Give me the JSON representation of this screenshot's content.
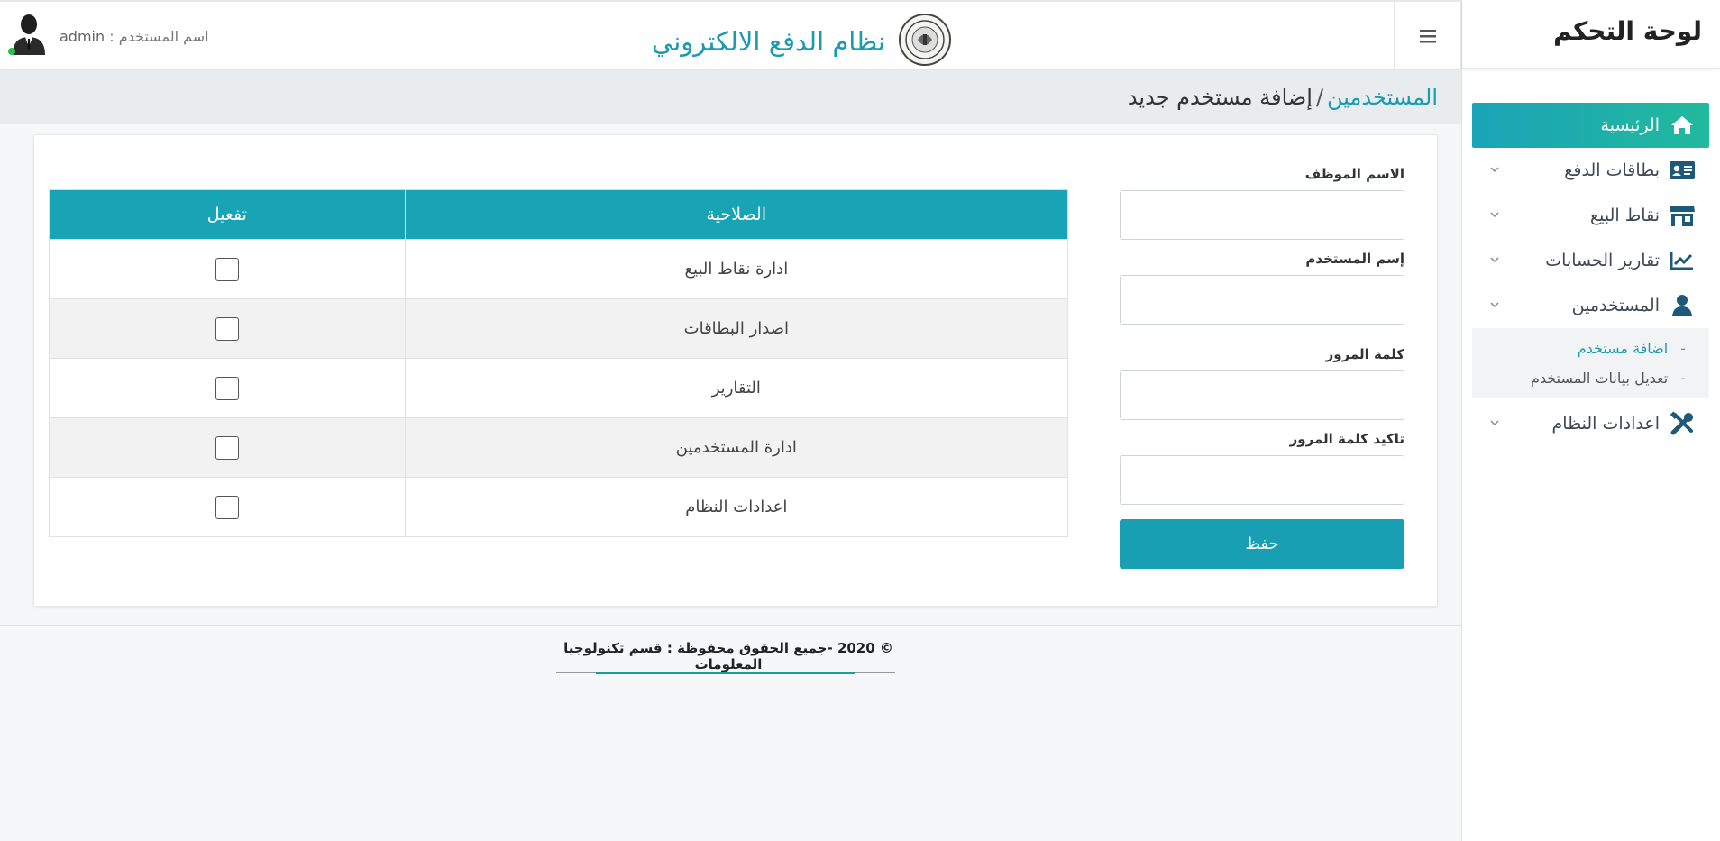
{
  "sidebar": {
    "title": "لوحة التحكم",
    "items": [
      {
        "label": "الرئيسية",
        "icon": "home-icon"
      },
      {
        "label": "بطاقات الدفع",
        "icon": "id-card-icon"
      },
      {
        "label": "نقاط البيع",
        "icon": "store-icon"
      },
      {
        "label": "تقارير الحسابات",
        "icon": "chart-icon"
      },
      {
        "label": "المستخدمين",
        "icon": "user-icon"
      },
      {
        "label": "اعدادات النظام",
        "icon": "tools-icon"
      }
    ],
    "users_submenu": [
      {
        "label": "اضافة مستخدم"
      },
      {
        "label": "تعديل بيانات المستخدم"
      }
    ],
    "sub_dash": "-"
  },
  "header": {
    "brand_title": "نظام الدفع الالكتروني",
    "user_label": "اسم المستخدم :",
    "user_name": "admin"
  },
  "breadcrumb": {
    "parent": "المستخدمين",
    "separator": "/",
    "current": "إضافة مستخدم جديد"
  },
  "form": {
    "employee_name_label": "الاسم الموظف",
    "employee_name_value": "",
    "username_label": "إسم المستخدم",
    "username_value": "",
    "password_label": "كلمة المرور",
    "password_value": "",
    "confirm_password_label": "تاكيد كلمة المرور",
    "confirm_password_value": "",
    "save_label": "حفظ"
  },
  "permissions": {
    "headers": {
      "permission": "الصلاحية",
      "activate": "تفعيل"
    },
    "rows": [
      {
        "label": "ادارة نقاط البيع",
        "checked": false
      },
      {
        "label": "اصدار البطاقات",
        "checked": false
      },
      {
        "label": "التقارير",
        "checked": false
      },
      {
        "label": "ادارة المستخدمين",
        "checked": false
      },
      {
        "label": "اعدادات النظام",
        "checked": false
      }
    ]
  },
  "footer": {
    "text": "© 2020 -جميع الحقوق محفوظة : قسم تكنولوجيا المعلومات"
  },
  "colors": {
    "accent": "#1a9bb0",
    "active_gradient_start": "#1aa4b8",
    "active_gradient_end": "#22b99c",
    "table_header": "#19a4b5",
    "online_dot": "#27c24c"
  }
}
